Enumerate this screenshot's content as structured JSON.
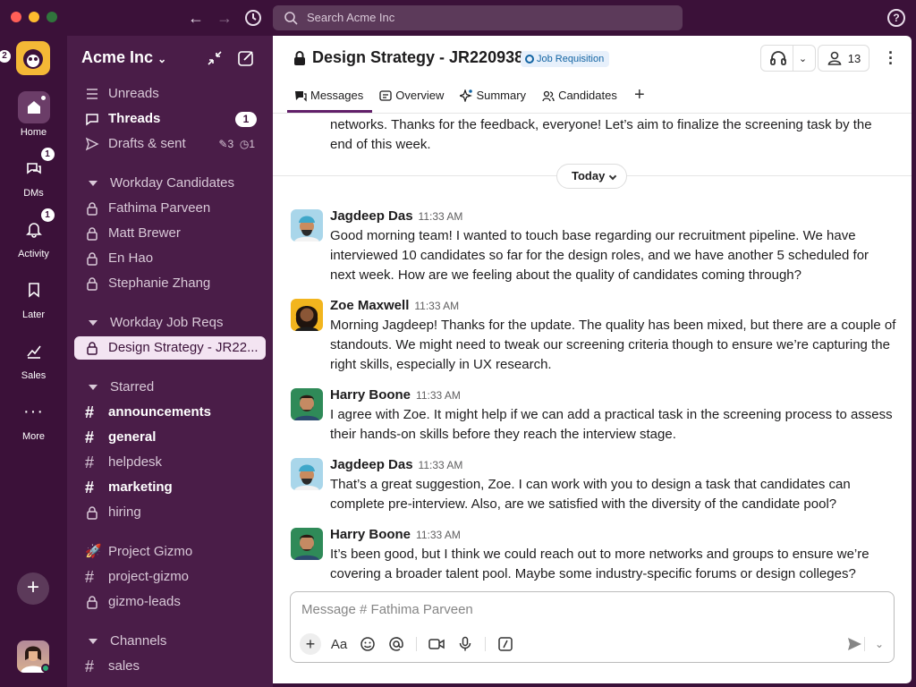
{
  "search": {
    "placeholder": "Search Acme Inc"
  },
  "rail": {
    "workspace_badge": "2",
    "items": [
      {
        "label": "Home",
        "badge": ""
      },
      {
        "label": "DMs",
        "badge": "1"
      },
      {
        "label": "Activity",
        "badge": "1"
      },
      {
        "label": "Later",
        "badge": ""
      },
      {
        "label": "Sales",
        "badge": ""
      },
      {
        "label": "More",
        "badge": ""
      }
    ]
  },
  "sidebar": {
    "workspace_name": "Acme Inc",
    "top": [
      {
        "label": "Unreads"
      },
      {
        "label": "Threads",
        "count": "1"
      },
      {
        "label": "Drafts & sent",
        "drafts": "3",
        "scheduled": "1"
      }
    ],
    "sections": [
      {
        "title": "Workday Candidates",
        "items": [
          "Fathima Parveen",
          "Matt Brewer",
          "En Hao",
          "Stephanie Zhang"
        ]
      },
      {
        "title": "Workday Job Reqs",
        "items": [
          "Design Strategy - JR22..."
        ]
      },
      {
        "title": "Starred",
        "items": [
          "announcements",
          "general",
          "helpdesk",
          "marketing",
          "hiring"
        ]
      },
      {
        "title": "",
        "items": [
          "Project Gizmo",
          "project-gizmo",
          "gizmo-leads"
        ]
      },
      {
        "title": "Channels",
        "items": [
          "sales"
        ]
      }
    ]
  },
  "channel": {
    "title": "Design Strategy - JR220938",
    "badge": "Job Requisition",
    "member_count": "13",
    "tabs": [
      "Messages",
      "Overview",
      "Summary",
      "Candidates"
    ]
  },
  "messages": {
    "continued": "networks. Thanks for the feedback, everyone! Let’s aim to finalize the screening task by the end of this week.",
    "day": "Today",
    "items": [
      {
        "name": "Jagdeep Das",
        "time": "11:33 AM",
        "text": "Good morning team! I wanted to touch base regarding our recruitment pipeline. We have interviewed 10 candidates so far for the design roles, and we have another 5 scheduled for next week. How are we feeling about the quality of candidates coming through?"
      },
      {
        "name": "Zoe Maxwell",
        "time": "11:33 AM",
        "text": "Morning Jagdeep! Thanks for the update. The quality has been mixed, but there are a couple of standouts. We might need to tweak our screening criteria though to ensure we’re capturing the right skills, especially in UX research."
      },
      {
        "name": "Harry Boone",
        "time": "11:33 AM",
        "text": "I agree with Zoe. It might help if we can add a practical task in the screening process to assess their hands-on skills before they reach the interview stage."
      },
      {
        "name": "Jagdeep Das",
        "time": "11:33 AM",
        "text": "That’s a great suggestion, Zoe. I can work with you to design a task that candidates can complete pre-interview. Also, are we satisfied with the diversity of the candidate pool?"
      },
      {
        "name": "Harry Boone",
        "time": "11:33 AM",
        "text": "It’s been good, but I think we could reach out to more networks and groups to ensure we’re covering a broader talent pool. Maybe some industry-specific forums or design colleges?"
      }
    ]
  },
  "composer": {
    "placeholder": "Message # Fathima Parveen",
    "format_label": "Aa"
  },
  "colors": {
    "aubergine": "#3b1139",
    "sidebar": "#4a1d48",
    "accent": "#611f69",
    "badge_blue": "#1264a3"
  }
}
